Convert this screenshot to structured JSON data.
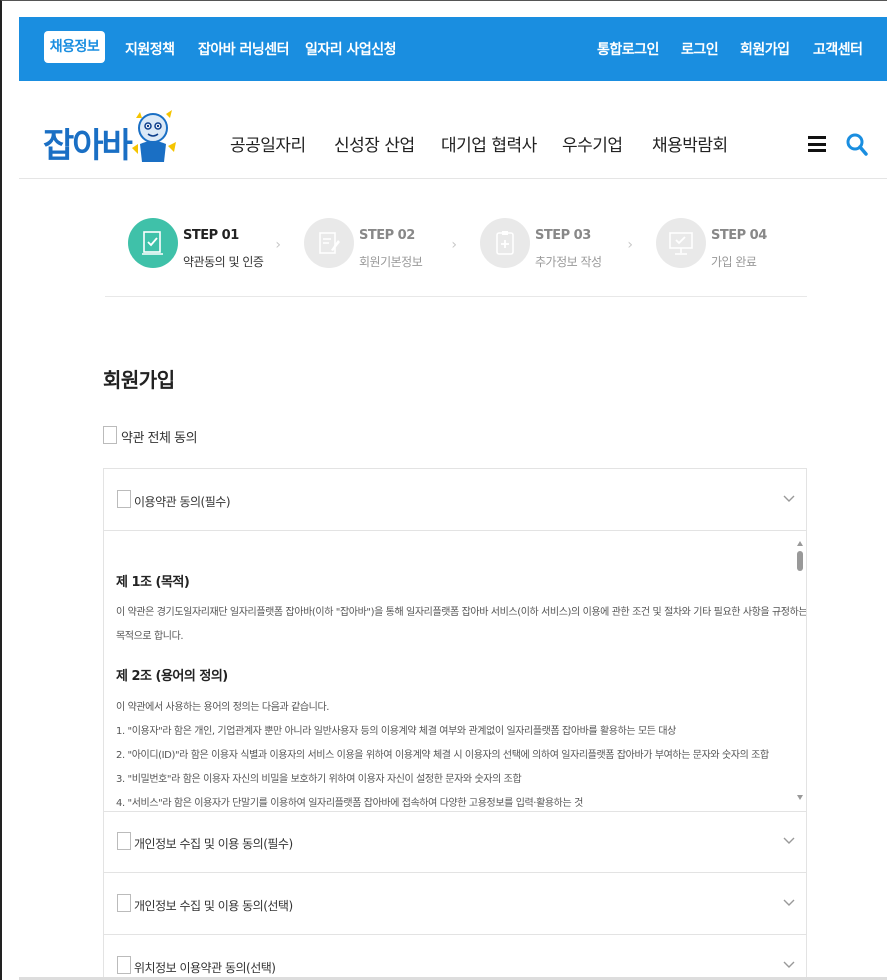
{
  "topbar": {
    "active_label": "채용정보",
    "left_items": [
      "지원정책",
      "잡아바 러닝센터",
      "일자리 사업신청"
    ],
    "right_items": [
      "통합로그인",
      "로그인",
      "회원가입",
      "고객센터"
    ]
  },
  "header": {
    "logo_text": "잡아바",
    "nav": [
      "공공일자리",
      "신성장 산업",
      "대기업 협력사",
      "우수기업",
      "채용박람회"
    ]
  },
  "steps": [
    {
      "num": "STEP 01",
      "label": "약관동의 및 인증",
      "active": true
    },
    {
      "num": "STEP 02",
      "label": "회원기본정보",
      "active": false
    },
    {
      "num": "STEP 03",
      "label": "추가정보 작성",
      "active": false
    },
    {
      "num": "STEP 04",
      "label": "가입 완료",
      "active": false
    }
  ],
  "page": {
    "title": "회원가입",
    "agree_all_label": "약관 전체 동의"
  },
  "accordions": [
    {
      "label": "이용약관 동의(필수)"
    },
    {
      "label": "개인정보 수집 및 이용 동의(필수)"
    },
    {
      "label": "개인정보 수집 및 이용 동의(선택)"
    },
    {
      "label": "위치정보 이용약관 동의(선택)"
    }
  ],
  "terms": {
    "article1_title": "제 1조 (목적)",
    "article1_line1": "이 약관은 경기도일자리재단 일자리플랫폼 잡아바(이하 \"잡아바\")을 통해 일자리플랫폼 잡아바 서비스(이하 서비스)의 이용에 관한 조건 및 절차와 기타 필요한 사항을 규정하는 것을",
    "article1_line2": "목적으로 합니다.",
    "article2_title": "제 2조 (용어의 정의)",
    "article2_intro": "이 약관에서 사용하는 용어의 정의는 다음과 같습니다.",
    "article2_items": [
      "1. \"이용자\"라 함은 개인, 기업관계자 뿐만 아니라 일반사용자 등의 이용계약 체결 여부와 관계없이 일자리플랫폼 잡아바를 활용하는 모든 대상",
      "2. \"아이디(ID)\"라 함은 이용자 식별과 이용자의 서비스 이용을 위하여 이용계약 체결 시 이용자의 선택에 의하여 일자리플랫폼 잡아바가 부여하는 문자와 숫자의 조합",
      "3. \"비밀번호\"라 함은 이용자 자신의 비밀을 보호하기 위하여 이용자 자신이 설정한 문자와 숫자의 조합",
      "4. \"서비스\"라 함은 이용자가 단말기를 이용하여 일자리플랫폼 잡아바에 접속하여 다양한 고용정보를 입력·활용하는 것"
    ]
  },
  "colors": {
    "brand_blue": "#1a8ee0",
    "step_active": "#3fc1a9"
  },
  "icons": {
    "menu": "hamburger-icon",
    "search": "search-icon",
    "chevron": "chevron-down-icon"
  }
}
